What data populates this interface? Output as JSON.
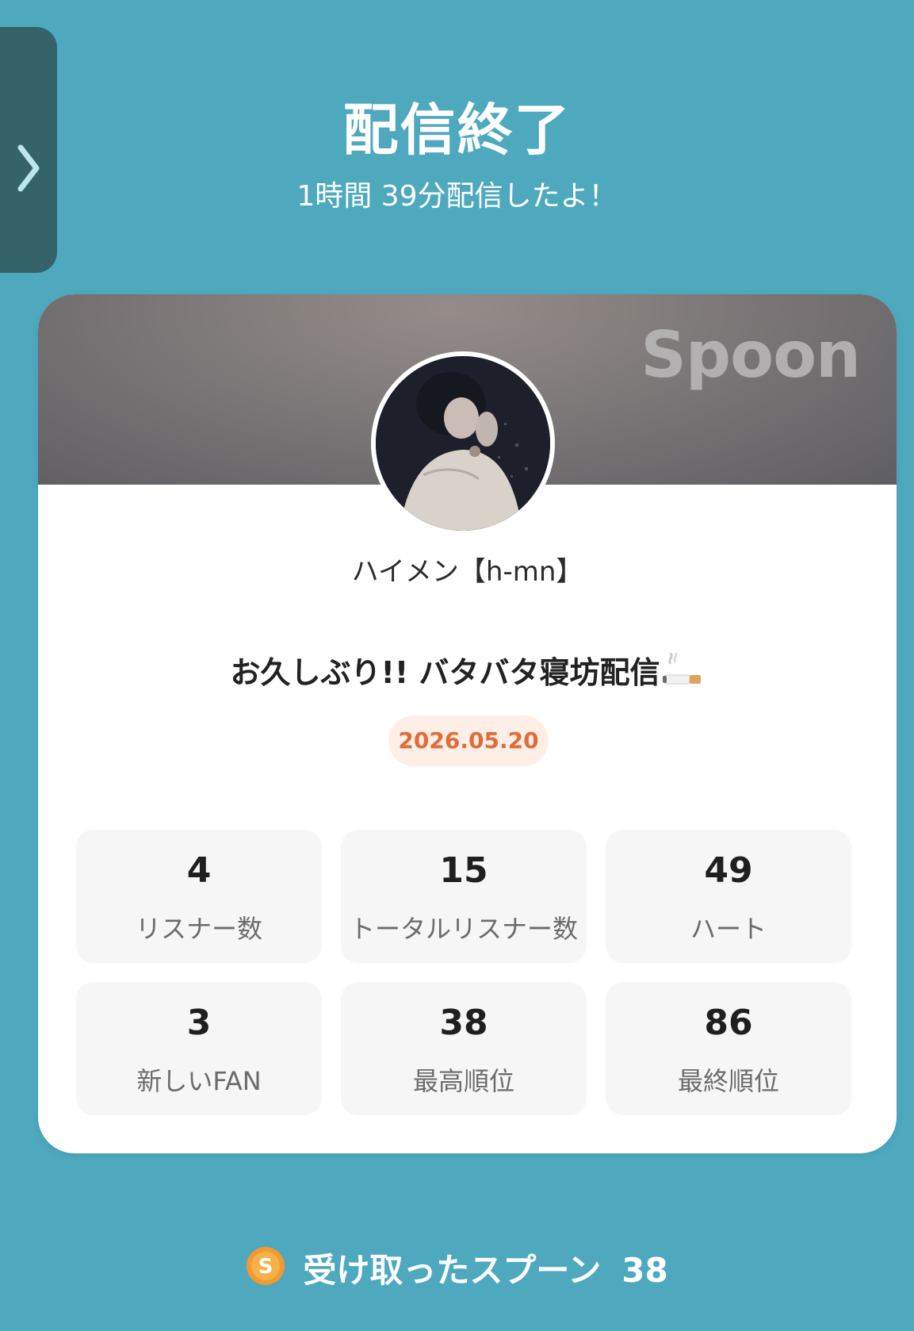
{
  "header": {
    "title": "配信終了",
    "subtitle": "1時間 39分配信したよ！"
  },
  "card": {
    "brand": "Spoon",
    "username": "ハイメン【h-mn】",
    "stream_title": "お久しぶり!! バタバタ寝坊配信",
    "date": "2026.05.20"
  },
  "stats": [
    {
      "value": "4",
      "label": "リスナー数"
    },
    {
      "value": "15",
      "label": "トータルリスナー数"
    },
    {
      "value": "49",
      "label": "ハート"
    },
    {
      "value": "3",
      "label": "新しいFAN"
    },
    {
      "value": "38",
      "label": "最高順位"
    },
    {
      "value": "86",
      "label": "最終順位"
    }
  ],
  "footer": {
    "received_label": "受け取ったスプーン",
    "received_count": "38"
  },
  "colors": {
    "background": "#4ea9bf",
    "accent": "#e36b3a",
    "coin": "#f39a2e"
  },
  "icons": {
    "side_tab": "chevron-right-icon",
    "title_emoji": "cigarette-icon",
    "footer_coin": "spoon-coin-icon"
  }
}
